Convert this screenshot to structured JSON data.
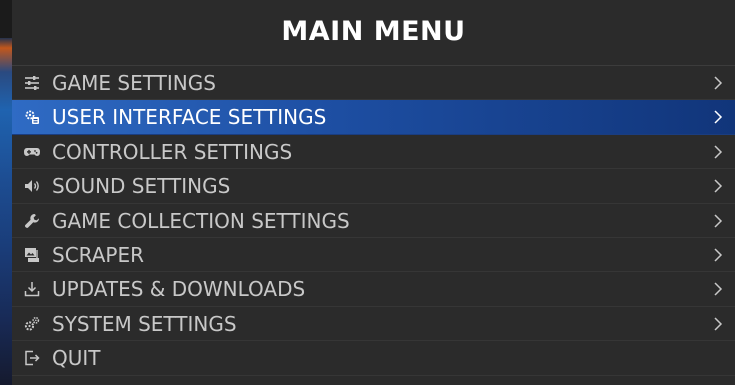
{
  "header": {
    "title": "MAIN MENU"
  },
  "menu": {
    "selected_index": 1,
    "items": [
      {
        "label": "GAME SETTINGS",
        "icon": "sliders-icon",
        "has_submenu": true
      },
      {
        "label": "USER INTERFACE SETTINGS",
        "icon": "ui-settings-icon",
        "has_submenu": true
      },
      {
        "label": "CONTROLLER SETTINGS",
        "icon": "gamepad-icon",
        "has_submenu": true
      },
      {
        "label": "SOUND SETTINGS",
        "icon": "speaker-icon",
        "has_submenu": true
      },
      {
        "label": "GAME COLLECTION SETTINGS",
        "icon": "wrench-icon",
        "has_submenu": true
      },
      {
        "label": "SCRAPER",
        "icon": "scraper-icon",
        "has_submenu": true
      },
      {
        "label": "UPDATES & DOWNLOADS",
        "icon": "download-icon",
        "has_submenu": true
      },
      {
        "label": "SYSTEM SETTINGS",
        "icon": "gears-icon",
        "has_submenu": true
      },
      {
        "label": "QUIT",
        "icon": "exit-icon",
        "has_submenu": false
      }
    ]
  },
  "colors": {
    "panel_background": "#2b2b2b",
    "text": "#c8c8c8",
    "selected_text": "#ffffff",
    "selected_gradient_start": "#2f6bc4",
    "selected_gradient_end": "#11357a"
  }
}
